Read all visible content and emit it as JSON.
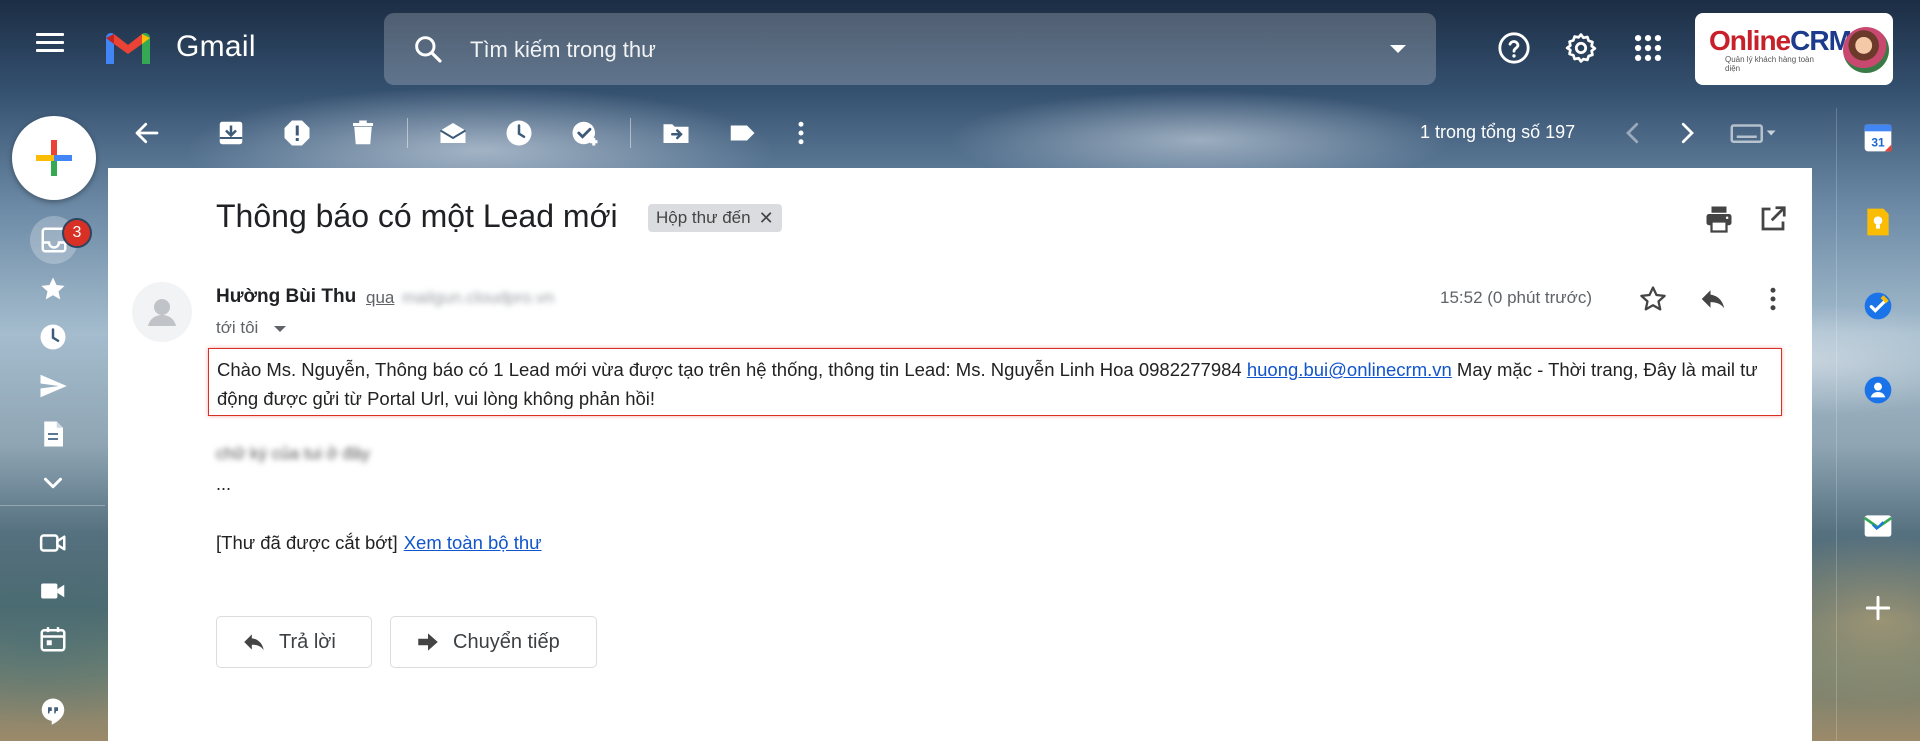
{
  "header": {
    "app_name": "Gmail",
    "search_placeholder": "Tìm kiếm trong thư",
    "account_logo": {
      "brand_main": "Online",
      "brand_accent": "CRM",
      "tagline": "Quản lý khách hàng toàn diện"
    }
  },
  "sidebar": {
    "inbox_badge": "3",
    "items": [
      {
        "name": "inbox",
        "icon": "inbox-icon"
      },
      {
        "name": "starred",
        "icon": "star-icon"
      },
      {
        "name": "snoozed",
        "icon": "clock-icon"
      },
      {
        "name": "sent",
        "icon": "send-icon"
      },
      {
        "name": "drafts",
        "icon": "draft-icon"
      },
      {
        "name": "more",
        "icon": "chevron-down-icon"
      },
      {
        "name": "meet-video",
        "icon": "video-icon"
      },
      {
        "name": "meet-join",
        "icon": "camcorder-icon"
      },
      {
        "name": "calendar",
        "icon": "calendar-icon"
      },
      {
        "name": "hangouts",
        "icon": "chat-icon"
      }
    ]
  },
  "toolbar": {
    "count_text": "1 trong tổng số 197"
  },
  "email": {
    "subject": "Thông báo có một Lead mới",
    "label": "Hộp thư đến",
    "sender_name": "Hường Bùi Thu",
    "via_text": "qua",
    "via_domain": "mailgun.cloudpro.vn",
    "to_text": "tới tôi",
    "time": "15:52 (0 phút trước)",
    "body_part1": "Chào    Ms. Nguyễn, Thông báo có 1 Lead mới vừa được tạo trên hệ thống, thông tin Lead: Ms. Nguyễn Linh Hoa 0982277984 ",
    "body_link": "huong.bui@onlinecrm.vn",
    "body_part2": " May mặc - Thời trang, Đây là mail tư động được gửi từ  Portal Url, vui lòng không phản hồi!",
    "signature": "chữ ký của tui ở đây",
    "ellipsis": "...",
    "trimmed_text": "[Thư đã được cắt bớt]",
    "view_full_link": "Xem toàn bộ thư",
    "reply_label": "Trả lời",
    "forward_label": "Chuyển tiếp"
  },
  "colors": {
    "gmail_red": "#EA4335",
    "gmail_blue": "#4285F4",
    "gmail_green": "#34A853",
    "gmail_yellow": "#FBBC04",
    "link": "#1155cc",
    "highlight_border": "#d93025"
  }
}
